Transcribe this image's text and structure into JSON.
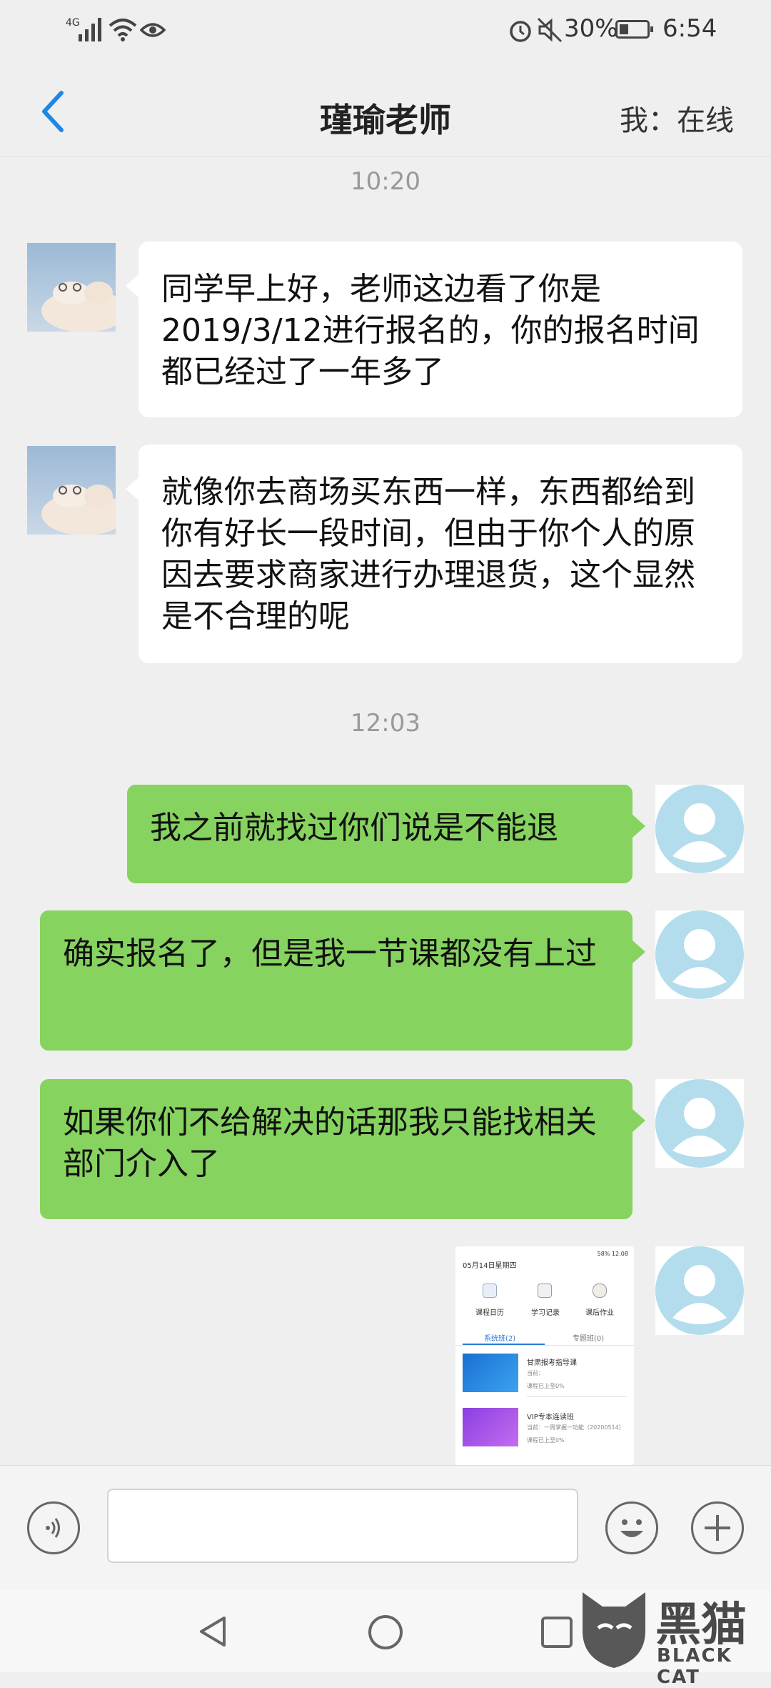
{
  "status_bar": {
    "network": "4G",
    "battery": "30%",
    "time": "6:54"
  },
  "header": {
    "title": "瑾瑜老师",
    "presence": "我：在线"
  },
  "messages": [
    {
      "type": "time",
      "text": "10:20"
    },
    {
      "type": "received",
      "text": "同学早上好，老师这边看了你是2019/3/12进行报名的，你的报名时间都已经过了一年多了"
    },
    {
      "type": "received",
      "text": "就像你去商场买东西一样，东西都给到你有好长一段时间，但由于你个人的原因去要求商家进行办理退货，这个显然是不合理的呢"
    },
    {
      "type": "time",
      "text": "12:03"
    },
    {
      "type": "sent",
      "text": "我之前就找过你们说是不能退"
    },
    {
      "type": "sent",
      "text": "确实报名了，但是我一节课都没有上过"
    },
    {
      "type": "sent",
      "text": "如果你们不给解决的话那我只能找相关部门介入了"
    }
  ],
  "screenshot_thumb": {
    "status": "58% 12:08",
    "date": "05月14日星期四",
    "icons": [
      "课程日历",
      "学习记录",
      "课后作业"
    ],
    "tabs": [
      "系统班(2)",
      "专题班(0)"
    ],
    "courses": [
      {
        "title": "甘肃报考指导课",
        "sub": "当前：",
        "progress": "课程已上至0%"
      },
      {
        "title": "VIP专本连读班",
        "sub": "当前：一周掌握一功能（20200514）",
        "progress": "课程已上至0%"
      }
    ]
  },
  "watermark": {
    "cn": "黑猫",
    "en": "BLACK CAT"
  },
  "colors": {
    "sent_bubble": "#86d35f",
    "received_bubble": "#ffffff",
    "accent": "#1e88e5",
    "background": "#efefef"
  }
}
